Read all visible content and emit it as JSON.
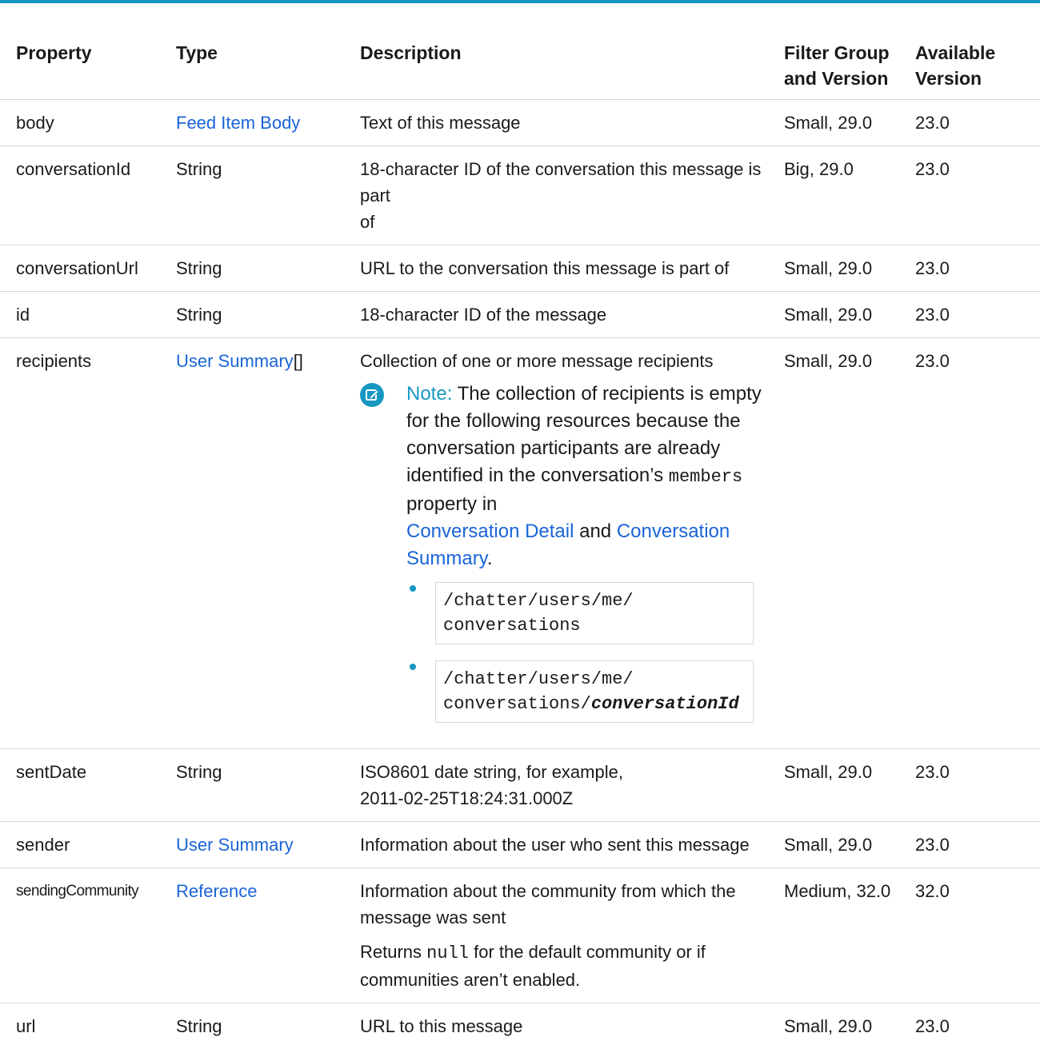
{
  "table": {
    "headers": {
      "property": "Property",
      "type": "Type",
      "description": "Description",
      "filter_group_line1": "Filter Group",
      "filter_group_line2": "and Version",
      "available_line1": "Available",
      "available_line2": "Version"
    },
    "rows": {
      "body": {
        "property": "body",
        "type": "Feed Item Body",
        "description": "Text of this message",
        "filter_group": "Small, 29.0",
        "available": "23.0"
      },
      "conversationId": {
        "property": "conversationId",
        "type": "String",
        "description_line1": "18-character ID of the conversation this message is part",
        "description_line2": "of",
        "filter_group": "Big, 29.0",
        "available": "23.0"
      },
      "conversationUrl": {
        "property": "conversationUrl",
        "type": "String",
        "description": "URL to the conversation this message is part of",
        "filter_group": "Small, 29.0",
        "available": "23.0"
      },
      "id": {
        "property": "id",
        "type": "String",
        "description": "18-character ID of the message",
        "filter_group": "Small, 29.0",
        "available": "23.0"
      },
      "recipients": {
        "property": "recipients",
        "type_link": "User Summary",
        "type_suffix": "[]",
        "description": "Collection of one or more message recipients",
        "filter_group": "Small, 29.0",
        "available": "23.0",
        "note": {
          "label": "Note:",
          "text_1": "The collection of recipients is empty for the following resources because the conversation participants are already identified in the conversation’s",
          "code_members": "members",
          "text_2": "property in",
          "link_1": "Conversation Detail",
          "text_3": "and",
          "link_2": "Conversation Summary",
          "text_4": ".",
          "code_items": [
            {
              "line1": "/chatter/users/me/",
              "line2": "conversations",
              "param": ""
            },
            {
              "line1": "/chatter/users/me/",
              "line2": "conversations/",
              "param": "conversationId"
            }
          ]
        }
      },
      "sentDate": {
        "property": "sentDate",
        "type": "String",
        "description_line1": "ISO8601 date string, for example,",
        "description_line2": "2011-02-25T18:24:31.000Z",
        "filter_group": "Small, 29.0",
        "available": "23.0"
      },
      "sender": {
        "property": "sender",
        "type": "User Summary",
        "description": "Information about the user who sent this message",
        "filter_group": "Small, 29.0",
        "available": "23.0"
      },
      "sendingCommunity": {
        "property": "sendingCommunity",
        "type": "Reference",
        "description_line1": "Information about the community from which the",
        "description_line2": "message was sent",
        "extra_1": "Returns",
        "extra_code": "null",
        "extra_2": "for the default community or if",
        "extra_line2": "communities aren’t enabled.",
        "filter_group": "Medium, 32.0",
        "available": "32.0"
      },
      "url": {
        "property": "url",
        "type": "String",
        "description": "URL to this message",
        "filter_group": "Small, 29.0",
        "available": "23.0"
      }
    }
  },
  "colors": {
    "accent": "#1798c1",
    "link": "#1a64d8",
    "rule": "#d8d8d8"
  },
  "icons": {
    "note": "pencil-edit-icon"
  }
}
